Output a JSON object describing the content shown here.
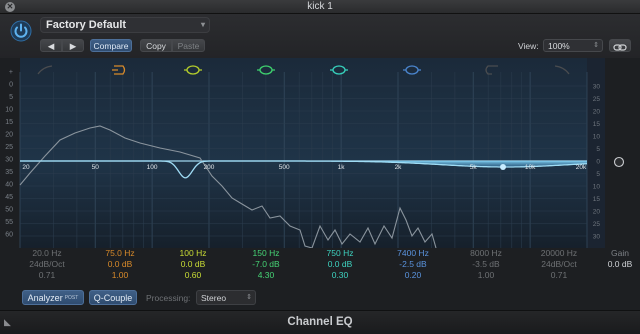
{
  "window": {
    "title": "kick 1",
    "close_symbol": "✕"
  },
  "toolbar": {
    "preset_name": "Factory Default",
    "prev_label": "◀",
    "next_label": "▶",
    "compare_label": "Compare",
    "copy_label": "Copy",
    "paste_label": "Paste",
    "view_label": "View:",
    "zoom_value": "100%"
  },
  "eq_display": {
    "freq_labels": [
      "20",
      "50",
      "100",
      "200",
      "500",
      "1k",
      "2k",
      "5k",
      "10k",
      "20k"
    ],
    "left_scale": [
      "+",
      "0",
      "5",
      "10",
      "15",
      "20",
      "25",
      "30",
      "35",
      "40",
      "45",
      "50",
      "55",
      "60"
    ],
    "right_scale": [
      "30",
      "25",
      "20",
      "15",
      "10",
      "5",
      "0",
      "5",
      "10",
      "15",
      "20",
      "25",
      "30"
    ],
    "accent_color": "#6ec3e6",
    "band_colors": [
      "#4a4c4f",
      "#d88a2a",
      "#b6cf2b",
      "#3fd36f",
      "#37d2bd",
      "#4b86cf",
      "#4a4c4f",
      "#4a4c4f"
    ]
  },
  "bands": [
    {
      "freq": "20.0 Hz",
      "gain": "24dB/Oct",
      "q": "0.71",
      "color": "#6e7174"
    },
    {
      "freq": "75.0 Hz",
      "gain": "0.0 dB",
      "q": "1.00",
      "color": "#d88a2a"
    },
    {
      "freq": "100 Hz",
      "gain": "0.0 dB",
      "q": "0.60",
      "color": "#c9dc35"
    },
    {
      "freq": "150 Hz",
      "gain": "-7.0 dB",
      "q": "4.30",
      "color": "#46d475"
    },
    {
      "freq": "750 Hz",
      "gain": "0.0 dB",
      "q": "0.30",
      "color": "#3ed3c0"
    },
    {
      "freq": "7400 Hz",
      "gain": "-2.5 dB",
      "q": "0.20",
      "color": "#5a93dd"
    },
    {
      "freq": "8000 Hz",
      "gain": "-3.5 dB",
      "q": "1.00",
      "color": "#6e7174"
    },
    {
      "freq": "20000 Hz",
      "gain": "24dB/Oct",
      "q": "0.71",
      "color": "#6e7174"
    }
  ],
  "gain": {
    "label": "Gain",
    "value": "0.0 dB"
  },
  "bottom": {
    "analyzer_label": "Analyzer",
    "analyzer_badge": "POST",
    "qcouple_label": "Q-Couple",
    "processing_label": "Processing:",
    "processing_value": "Stereo"
  },
  "footer": {
    "plugin_name": "Channel EQ",
    "corner_glyph": "◣"
  }
}
